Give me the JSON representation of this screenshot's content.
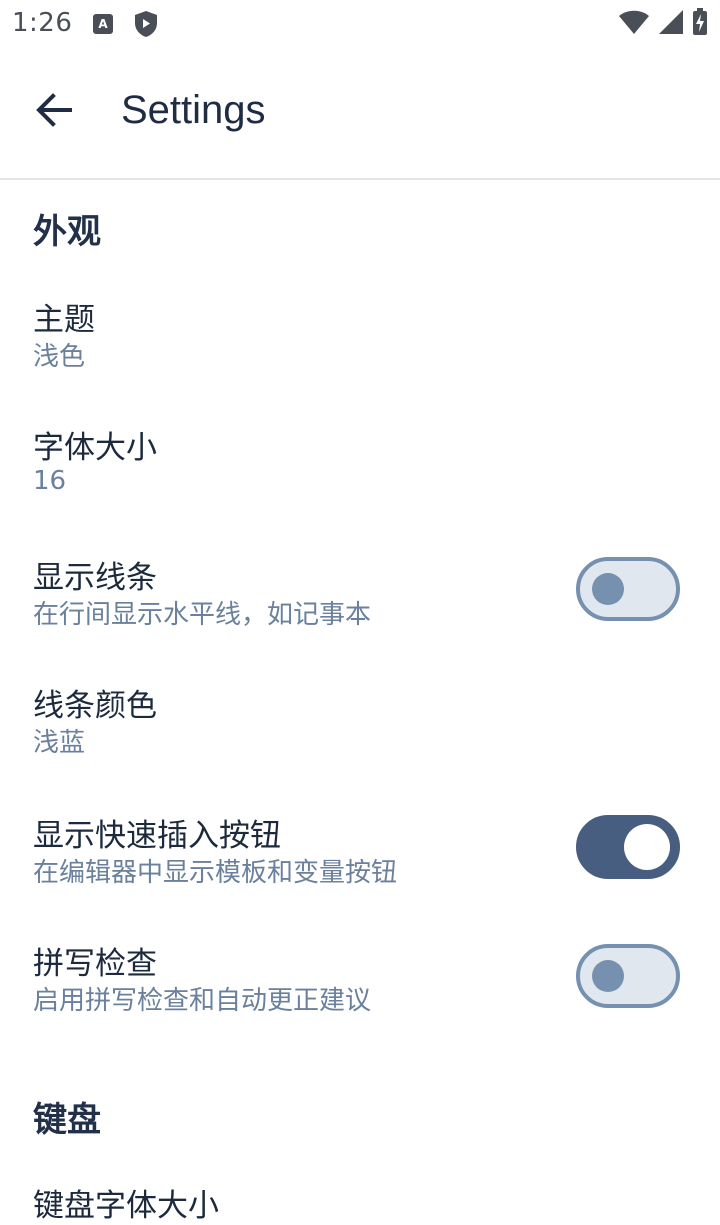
{
  "status_bar": {
    "time": "1:26",
    "left_icons": [
      "text-recognition-icon",
      "shield-play-icon"
    ],
    "right_icons": [
      "wifi-icon",
      "cellular-signal-icon",
      "battery-charging-icon"
    ]
  },
  "app_bar": {
    "back_icon": "arrow-back-icon",
    "title": "Settings"
  },
  "sections": {
    "appearance": {
      "header": "外观",
      "theme": {
        "title": "主题",
        "value": "浅色"
      },
      "font_size": {
        "title": "字体大小",
        "value": "16"
      },
      "show_lines": {
        "title": "显示线条",
        "subtitle": "在行间显示水平线，如记事本",
        "enabled": false
      },
      "line_color": {
        "title": "线条颜色",
        "value": "浅蓝"
      },
      "quick_insert": {
        "title": "显示快速插入按钮",
        "subtitle": "在编辑器中显示模板和变量按钮",
        "enabled": true
      },
      "spell_check": {
        "title": "拼写检查",
        "subtitle": "启用拼写检查和自动更正建议",
        "enabled": false
      }
    },
    "keyboard": {
      "header": "键盘",
      "keyboard_font_size": {
        "title": "键盘字体大小"
      }
    }
  },
  "colors": {
    "accent": "#485e81",
    "switch_off_track": "#e1e7ef",
    "switch_off_border": "#7690b0",
    "subtitle_text": "#6a809c"
  }
}
